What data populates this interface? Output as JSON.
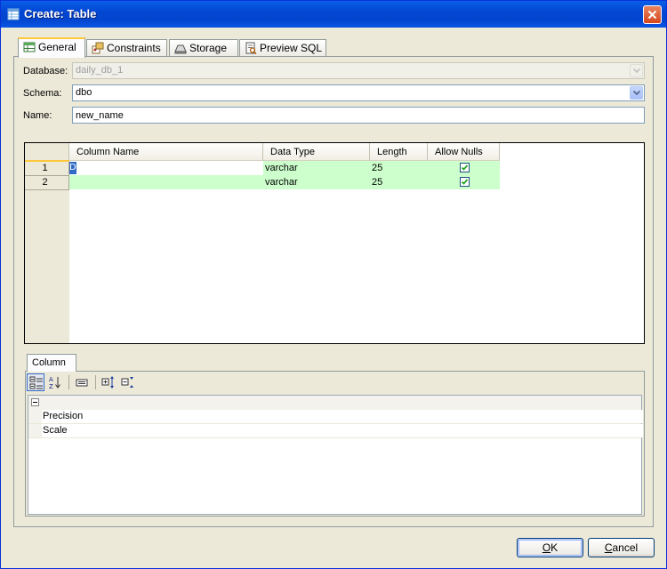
{
  "window": {
    "title": "Create: Table"
  },
  "tabs": [
    {
      "label": "General",
      "icon": "table-grid-icon",
      "active": true
    },
    {
      "label": "Constraints",
      "icon": "constraints-icon",
      "active": false
    },
    {
      "label": "Storage",
      "icon": "storage-icon",
      "active": false
    },
    {
      "label": "Preview SQL",
      "icon": "preview-sql-icon",
      "active": false
    }
  ],
  "form": {
    "database_label": "Database:",
    "database_value": "daily_db_1",
    "schema_label": "Schema:",
    "schema_value": "dbo",
    "name_label": "Name:",
    "name_value": "new_name"
  },
  "columns_grid": {
    "headers": [
      "Column Name",
      "Data Type",
      "Length",
      "Allow Nulls"
    ],
    "rows": [
      {
        "num": "1",
        "name": "",
        "type": "varchar",
        "length": "25",
        "allow_nulls": true,
        "editing_text": "D"
      },
      {
        "num": "2",
        "name": "",
        "type": "varchar",
        "length": "25",
        "allow_nulls": true
      }
    ]
  },
  "column_panel": {
    "tab_label": "Column",
    "toolbar": [
      "categorized-icon",
      "alphabetical-sort-icon",
      "property-pages-icon",
      "expand-all-icon",
      "collapse-all-icon"
    ],
    "properties": [
      {
        "name": "Precision",
        "value": ""
      },
      {
        "name": "Scale",
        "value": ""
      }
    ]
  },
  "buttons": {
    "ok_prefix": "",
    "ok_hotkey": "O",
    "ok_rest": "K",
    "cancel_hotkey": "C",
    "cancel_rest": "ancel"
  },
  "colors": {
    "row_highlight": "#ccffcc",
    "active_tab_accent": "#ffc83c",
    "titlebar": "#0347d4"
  }
}
